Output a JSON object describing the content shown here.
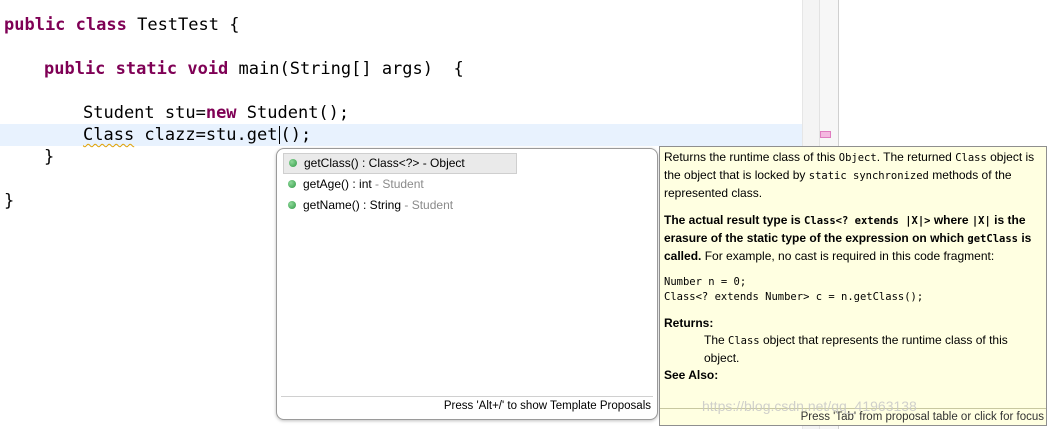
{
  "editor": {
    "line1": {
      "kw1": "public",
      "kw2": "class",
      "rest": " TestTest {"
    },
    "line2": {
      "kw1": "public",
      "kw2": "static",
      "kw3": "void",
      "rest": " main(String[] args)  {"
    },
    "line3": {
      "pre": "Student stu=",
      "kw": "new",
      "post": " Student();"
    },
    "line4": {
      "squiggle": "Class",
      "mid": " clazz=stu.",
      "get": "get",
      "post": "();"
    },
    "line5": "}",
    "line6": "}"
  },
  "proposals": {
    "items": [
      {
        "sig": "getClass() : Class<?>",
        "decl": " - Object"
      },
      {
        "sig": "getAge() : int",
        "decl": " - Student"
      },
      {
        "sig": "getName() : String",
        "decl": " - Student"
      }
    ],
    "status": "Press 'Alt+/' to show Template Proposals"
  },
  "javadoc": {
    "p1_a": "Returns the runtime class of this ",
    "p1_code1": "Object",
    "p1_b": ". The returned ",
    "p1_code2": "Class",
    "p1_c": " object is the object that is locked by ",
    "p1_code3": "static synchronized",
    "p1_d": " methods of the represented class.",
    "p2_a": "The actual result type is ",
    "p2_code1": "Class<? extends |X|>",
    "p2_b": " where ",
    "p2_code2": "|X|",
    "p2_c": " is the erasure of the static type of the expression on which ",
    "p2_code3": "getClass",
    "p2_d": " is called.",
    "p2_e": " For example, no cast is required in this code fragment:",
    "code_line1": "Number n = 0;",
    "code_line2": "Class<? extends Number> c = n.getClass();",
    "returns_label": "Returns:",
    "returns_a": "The ",
    "returns_code": "Class",
    "returns_b": " object that represents the runtime class of this object.",
    "see_also_label": "See Also:",
    "status": "Press 'Tab' from proposal table or click for focus"
  },
  "watermark": "https://blog.csdn.net/qq_41963138"
}
